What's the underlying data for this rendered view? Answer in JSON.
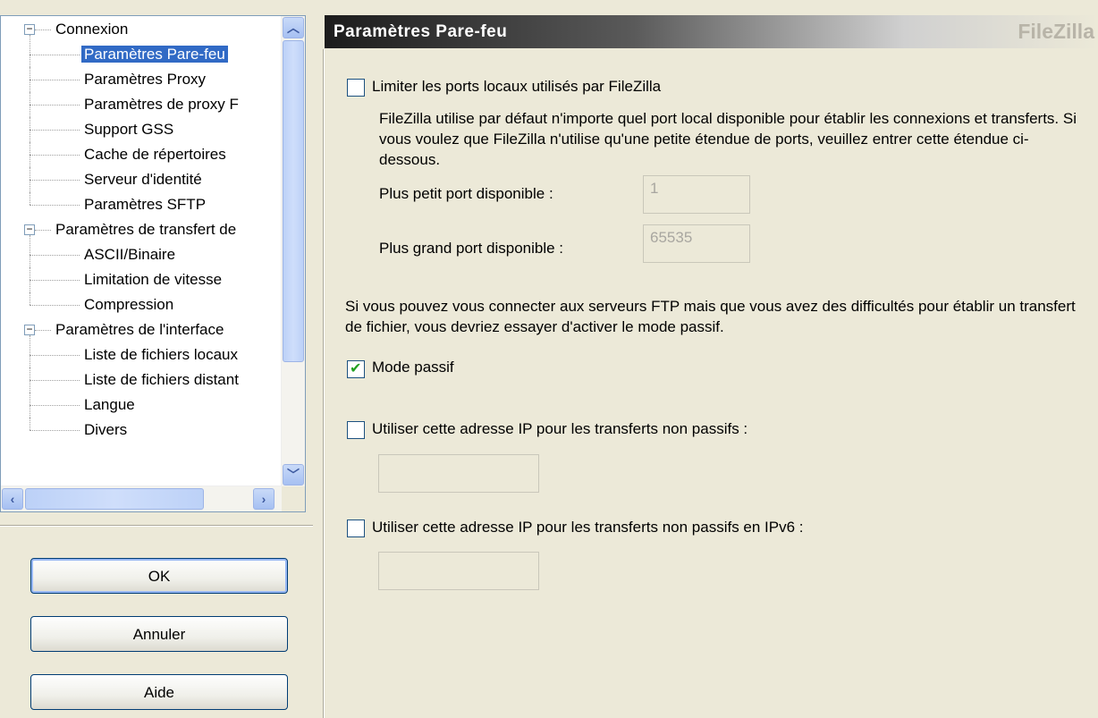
{
  "tree": {
    "items": [
      {
        "label": "Connexion",
        "level": 0,
        "expanded": true
      },
      {
        "label": "Paramètres Pare-feu",
        "level": 1,
        "selected": true
      },
      {
        "label": "Paramètres Proxy",
        "level": 1
      },
      {
        "label": "Paramètres de proxy F",
        "level": 1
      },
      {
        "label": "Support GSS",
        "level": 1
      },
      {
        "label": "Cache de répertoires",
        "level": 1
      },
      {
        "label": "Serveur d'identité",
        "level": 1
      },
      {
        "label": "Paramètres SFTP",
        "level": 1
      },
      {
        "label": "Paramètres de transfert de",
        "level": 0,
        "expanded": true
      },
      {
        "label": "ASCII/Binaire",
        "level": 1
      },
      {
        "label": "Limitation de vitesse",
        "level": 1
      },
      {
        "label": "Compression",
        "level": 1
      },
      {
        "label": "Paramètres de l'interface",
        "level": 0,
        "expanded": true
      },
      {
        "label": "Liste de fichiers locaux",
        "level": 1
      },
      {
        "label": "Liste de fichiers distant",
        "level": 1
      },
      {
        "label": "Langue",
        "level": 1
      },
      {
        "label": "Divers",
        "level": 1
      }
    ],
    "expander_symbol": "−"
  },
  "buttons": {
    "ok": "OK",
    "cancel": "Annuler",
    "help": "Aide"
  },
  "header": {
    "title": "Paramètres Pare-feu",
    "brand": "FileZilla"
  },
  "settings": {
    "limit_ports": {
      "label": "Limiter les ports locaux utilisés par FileZilla",
      "checked": false,
      "description": "FileZilla utilise par défaut n'importe quel port local disponible pour établir les connexions et transferts. Si vous voulez que FileZilla n'utilise qu'une petite étendue de ports, veuillez entrer cette étendue ci-dessous.",
      "min_label": "Plus petit port disponible :",
      "min_value": "1",
      "max_label": "Plus grand port disponible :",
      "max_value": "65535"
    },
    "passive_info": "Si vous pouvez vous connecter aux serveurs FTP mais que vous avez des difficultés pour établir un transfert de fichier, vous devriez essayer d'activer le mode passif.",
    "passive_mode": {
      "label": "Mode passif",
      "checked": true
    },
    "ip_override": {
      "label": "Utiliser cette adresse IP pour les transferts non passifs :",
      "checked": false,
      "value": ""
    },
    "ip6_override": {
      "label": "Utiliser cette adresse IP pour les transferts non passifs en IPv6 :",
      "checked": false,
      "value": ""
    }
  }
}
